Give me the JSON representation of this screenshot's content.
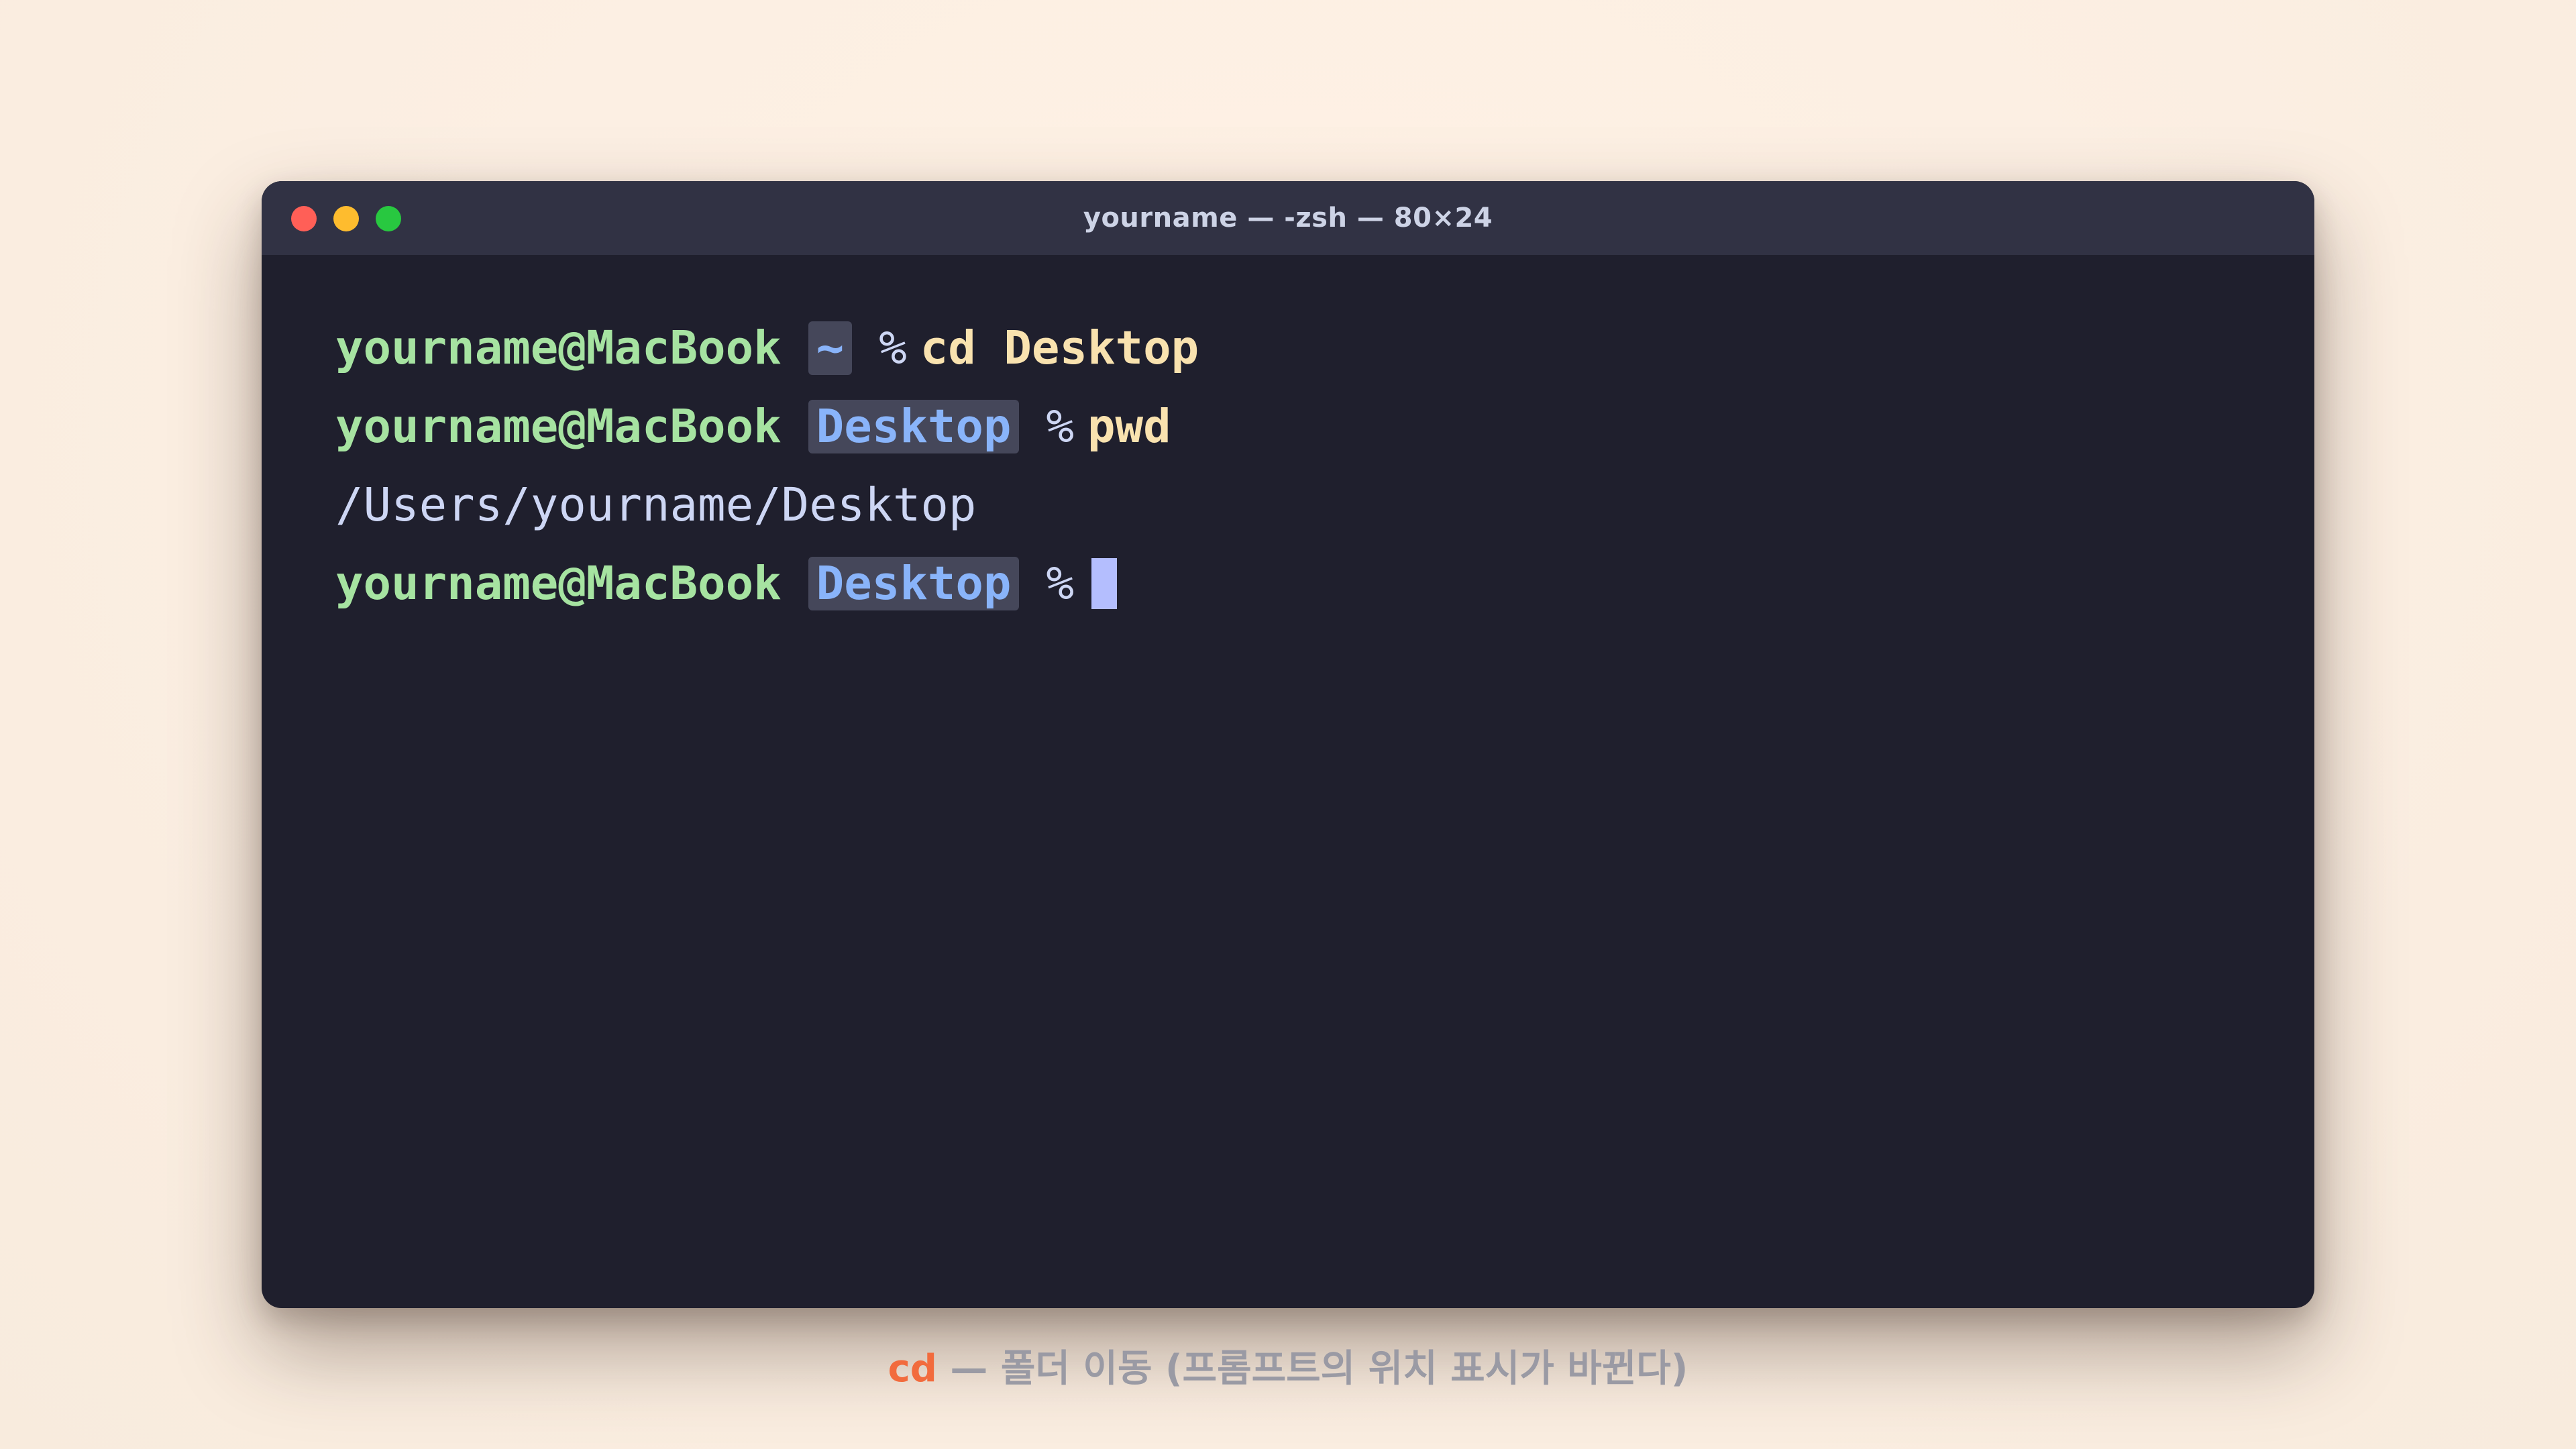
{
  "window": {
    "title": "yourname — -zsh — 80×24"
  },
  "terminal": {
    "lines": [
      {
        "user": "yourname@MacBook",
        "dir": "~",
        "prompt": "%",
        "command": "cd Desktop"
      },
      {
        "user": "yourname@MacBook",
        "dir": "Desktop",
        "prompt": "%",
        "command": "pwd"
      },
      {
        "output": "/Users/yourname/Desktop"
      },
      {
        "user": "yourname@MacBook",
        "dir": "Desktop",
        "prompt": "%",
        "command": ""
      }
    ]
  },
  "caption": {
    "command": "cd",
    "text": " — 폴더 이동 (프롬프트의 위치 표시가 바뀐다)"
  },
  "colors": {
    "background": "#fdf0e3",
    "window": "#1f1f2d",
    "titlebar": "#313244",
    "user": "#a6e3a1",
    "directory": "#89b4fa",
    "command": "#f9e2af",
    "output": "#cdd6f4",
    "cursor": "#b4befe",
    "caption_accent": "#f26b3d",
    "caption_text": "#9a9aa4"
  }
}
